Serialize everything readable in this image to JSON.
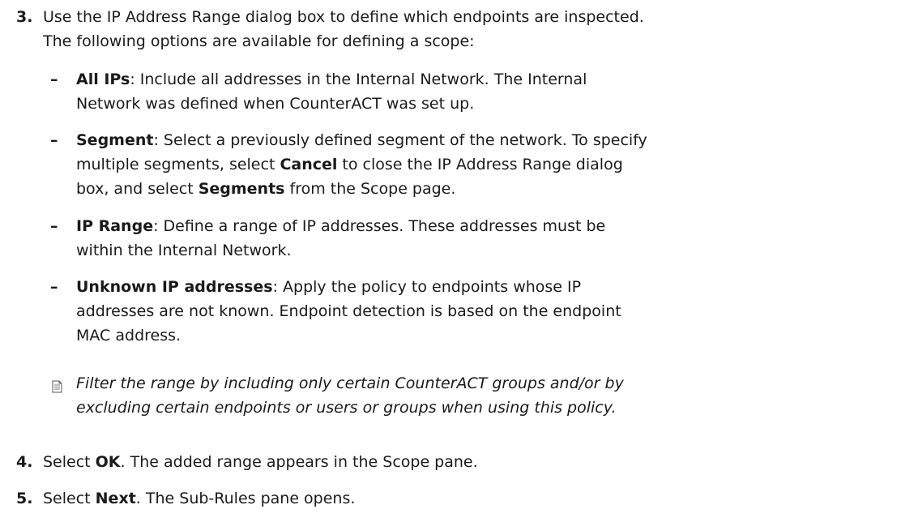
{
  "steps": [
    {
      "number": "3.",
      "lines": [
        "Use the IP Address Range dialog box to define which endpoints are inspected.",
        "The following options are available for defining a scope:"
      ],
      "options": [
        {
          "term": "All IPs",
          "lines": [
            ": Include all addresses in the Internal Network. The Internal",
            "Network was defined when CounterACT was set up."
          ]
        },
        {
          "term": "Segment",
          "line1_rest": ": Select a previously defined segment of the network. To specify",
          "line2_a": "multiple segments, select ",
          "line2_bold": "Cancel",
          "line2_b": " to close the IP Address Range dialog",
          "line3_a": "box, and select ",
          "line3_bold": "Segments",
          "line3_b": " from the Scope page."
        },
        {
          "term": "IP Range",
          "lines": [
            ": Define a range of IP addresses. These addresses must be",
            "within the Internal Network."
          ]
        },
        {
          "term": "Unknown IP addresses",
          "lines": [
            ": Apply the policy to endpoints whose IP",
            "addresses are not known. Endpoint detection is based on the endpoint",
            "MAC address."
          ]
        }
      ],
      "note": {
        "icon": "note-icon",
        "lines": [
          "Filter the range by including only certain CounterACT groups and/or by",
          "excluding certain endpoints or users or groups when using this policy."
        ]
      }
    },
    {
      "number": "4.",
      "text_a": "Select ",
      "text_bold": "OK",
      "text_b": ". The added range appears in the Scope pane."
    },
    {
      "number": "5.",
      "text_a": "Select ",
      "text_bold": "Next",
      "text_b": ". The Sub-Rules pane opens."
    }
  ],
  "bullet_dash": "–"
}
